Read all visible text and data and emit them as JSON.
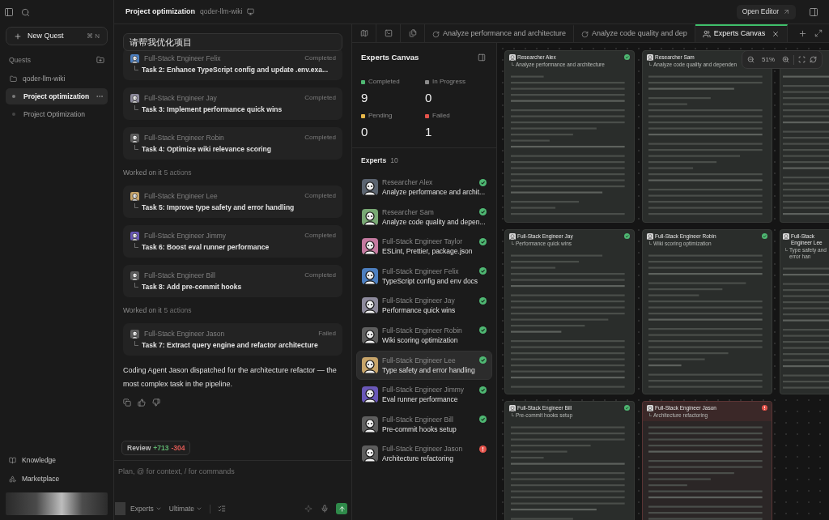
{
  "sidebar": {
    "new_quest": {
      "label": "New Quest",
      "shortcut": "⌘ N"
    },
    "section": "Quests",
    "items": [
      {
        "kind": "folder",
        "label": "qoder-llm-wiki",
        "selected": false
      },
      {
        "kind": "quest",
        "label": "Project optimization",
        "selected": true
      },
      {
        "kind": "quest",
        "label": "Project Optimization",
        "selected": false
      }
    ],
    "footer": [
      {
        "kind": "knowledge",
        "label": "Knowledge"
      },
      {
        "kind": "marketplace",
        "label": "Marketplace"
      }
    ]
  },
  "header": {
    "title": "Project optimization",
    "repo": "qoder-llm-wiki",
    "open_editor": "Open Editor"
  },
  "chat": {
    "user_message": "请帮我优化项目",
    "feed": [
      {
        "kind": "task",
        "agent": "Full-Stack Engineer Felix",
        "status": "Completed",
        "task": "Task 2: Enhance TypeScript config and update .env.exa...",
        "color": "#4d7fc0"
      },
      {
        "kind": "task",
        "agent": "Full-Stack Engineer Jay",
        "status": "Completed",
        "task": "Task 3: Implement performance quick wins",
        "color": "#8d8a9c"
      },
      {
        "kind": "task",
        "agent": "Full-Stack Engineer Robin",
        "status": "Completed",
        "task": "Task 4: Optimize wiki relevance scoring",
        "color": "#5f5f5f"
      },
      {
        "kind": "summary",
        "label": "Worked on it",
        "count": "5 actions"
      },
      {
        "kind": "task",
        "agent": "Full-Stack Engineer Lee",
        "status": "Completed",
        "task": "Task 5: Improve type safety and error handling",
        "color": "#c8a56a"
      },
      {
        "kind": "task",
        "agent": "Full-Stack Engineer Jimmy",
        "status": "Completed",
        "task": "Task 6: Boost eval runner performance",
        "color": "#6a58b8"
      },
      {
        "kind": "task",
        "agent": "Full-Stack Engineer Bill",
        "status": "Completed",
        "task": "Task 8: Add pre-commit hooks",
        "color": "#5e5e5e"
      },
      {
        "kind": "summary",
        "label": "Worked on it",
        "count": "5 actions"
      },
      {
        "kind": "task",
        "agent": "Full-Stack Engineer Jason",
        "status": "Failed",
        "task": "Task 7: Extract query engine and refactor architecture",
        "color": "#5d5d5d"
      }
    ],
    "reply": "Coding Agent Jason dispatched for the architecture refactor — the most complex task in the pipeline.",
    "review": {
      "label": "Review",
      "added": "+713",
      "removed": "-304"
    },
    "input": {
      "placeholder": "Plan, @ for context, / for commands"
    },
    "mode": "Experts",
    "model": "Ultimate"
  },
  "tabs": [
    {
      "kind": "task",
      "label": "Analyze performance and architecture",
      "selected": false
    },
    {
      "kind": "task",
      "label": "Analyze code quality and dep",
      "selected": false
    },
    {
      "kind": "canvas",
      "label": "Experts Canvas",
      "selected": true
    }
  ],
  "experts_panel": {
    "title": "Experts Canvas",
    "stats": [
      {
        "label": "Completed",
        "value": "9",
        "color": "#4fb873"
      },
      {
        "label": "In Progress",
        "value": "0",
        "color": "#8c8c8c"
      },
      {
        "label": "Pending",
        "value": "0",
        "color": "#e8b84a"
      },
      {
        "label": "Failed",
        "value": "1",
        "color": "#e5534b"
      }
    ],
    "list_title": "Experts",
    "count": "10",
    "list": [
      {
        "name": "Researcher Alex",
        "task": "Analyze performance and archit...",
        "kind": "completed",
        "selected": false,
        "color": "#5b6470"
      },
      {
        "name": "Researcher Sam",
        "task": "Analyze code quality and depen...",
        "kind": "completed",
        "selected": false,
        "color": "#78a874"
      },
      {
        "name": "Full-Stack Engineer Taylor",
        "task": "ESLint, Prettier, package.json",
        "kind": "completed",
        "selected": false,
        "color": "#c47aa0"
      },
      {
        "name": "Full-Stack Engineer Felix",
        "task": "TypeScript config and env docs",
        "kind": "completed",
        "selected": false,
        "color": "#4d7fc0"
      },
      {
        "name": "Full-Stack Engineer Jay",
        "task": "Performance quick wins",
        "kind": "completed",
        "selected": false,
        "color": "#8d8a9c"
      },
      {
        "name": "Full-Stack Engineer Robin",
        "task": "Wiki scoring optimization",
        "kind": "completed",
        "selected": false,
        "color": "#5f5f5f"
      },
      {
        "name": "Full-Stack Engineer Lee",
        "task": "Type safety and error handling",
        "kind": "completed",
        "selected": true,
        "color": "#c8a56a"
      },
      {
        "name": "Full-Stack Engineer Jimmy",
        "task": "Eval runner performance",
        "kind": "completed",
        "selected": false,
        "color": "#6a58b8"
      },
      {
        "name": "Full-Stack Engineer Bill",
        "task": "Pre-commit hooks setup",
        "kind": "completed",
        "selected": false,
        "color": "#5e5e5e"
      },
      {
        "name": "Full-Stack Engineer Jason",
        "task": "Architecture refactoring",
        "kind": "failed",
        "selected": false,
        "color": "#5d5d5d"
      }
    ]
  },
  "canvas": {
    "zoom": "51%",
    "rows": [
      [
        {
          "agent": "Researcher Alex",
          "task": "Analyze performance and architecture",
          "kind": "completed"
        },
        {
          "agent": "Researcher Sam",
          "task": "Analyze code quality and dependen"
        },
        {}
      ],
      [
        {
          "agent": "Full-Stack Engineer Jay",
          "task": "Performance quick wins",
          "kind": "completed"
        },
        {
          "agent": "Full-Stack Engineer Robin",
          "task": "Wiki scoring optimization",
          "kind": "completed"
        },
        {
          "agent": "Full-Stack Engineer Lee",
          "task": "Type safety and error han"
        }
      ],
      [
        {
          "agent": "Full-Stack Engineer Bill",
          "task": "Pre-commit hooks setup",
          "kind": "completed"
        },
        {
          "agent": "Full-Stack Engineer Jason",
          "task": "Architecture refactoring",
          "kind": "failed"
        }
      ]
    ]
  }
}
